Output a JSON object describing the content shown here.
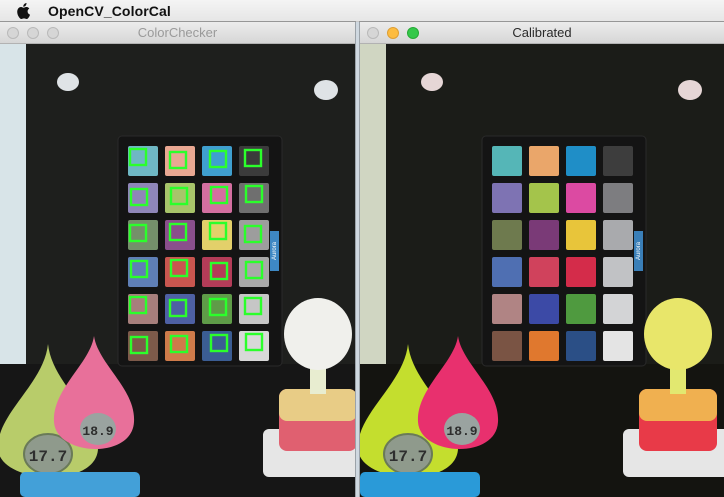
{
  "menubar": {
    "app_name": "OpenCV_ColorCal",
    "apple_icon": "apple-logo-icon"
  },
  "windows": {
    "left": {
      "title": "ColorChecker",
      "state": "inactive"
    },
    "right": {
      "title": "Calibrated",
      "state": "active"
    }
  },
  "scene": {
    "board_label": "Aurora",
    "clock_reading": "17.7",
    "pink_clock_reading": "18.9"
  },
  "colors": {
    "detection_box": "#2bff2b",
    "close": "#fc605c",
    "minimize": "#fdbc40",
    "zoom": "#34c84a"
  },
  "color_patches": {
    "raw": [
      [
        "#6fb7c4",
        "#e9a792",
        "#3f9fcf",
        "#3b3b3b"
      ],
      [
        "#8f86b8",
        "#a8c46a",
        "#d46fa0",
        "#6f6f6f"
      ],
      [
        "#74906a",
        "#8a4f8c",
        "#e3d06a",
        "#9d9d9d"
      ],
      [
        "#5f7fb6",
        "#c9564f",
        "#b43c58",
        "#a9a9a9"
      ],
      [
        "#a77f7c",
        "#4e60a4",
        "#5f9c48",
        "#c6c6c6"
      ],
      [
        "#7d5a4a",
        "#cf7b4a",
        "#3b5d93",
        "#d8d8d8"
      ]
    ],
    "calibrated": [
      [
        "#55b6b7",
        "#eaa66a",
        "#1f8ec7",
        "#3d3d3d"
      ],
      [
        "#7e73b3",
        "#a4c44b",
        "#dc4aa2",
        "#7d7d80"
      ],
      [
        "#6e7a4e",
        "#7a3a77",
        "#e8c53a",
        "#a9aaad"
      ],
      [
        "#4f6fb2",
        "#d0425c",
        "#d42c4a",
        "#c1c2c5"
      ],
      [
        "#b08484",
        "#3c4aa6",
        "#4f9a3f",
        "#d3d4d6"
      ],
      [
        "#7a5444",
        "#e0782e",
        "#2b4f86",
        "#e4e4e4"
      ]
    ]
  }
}
